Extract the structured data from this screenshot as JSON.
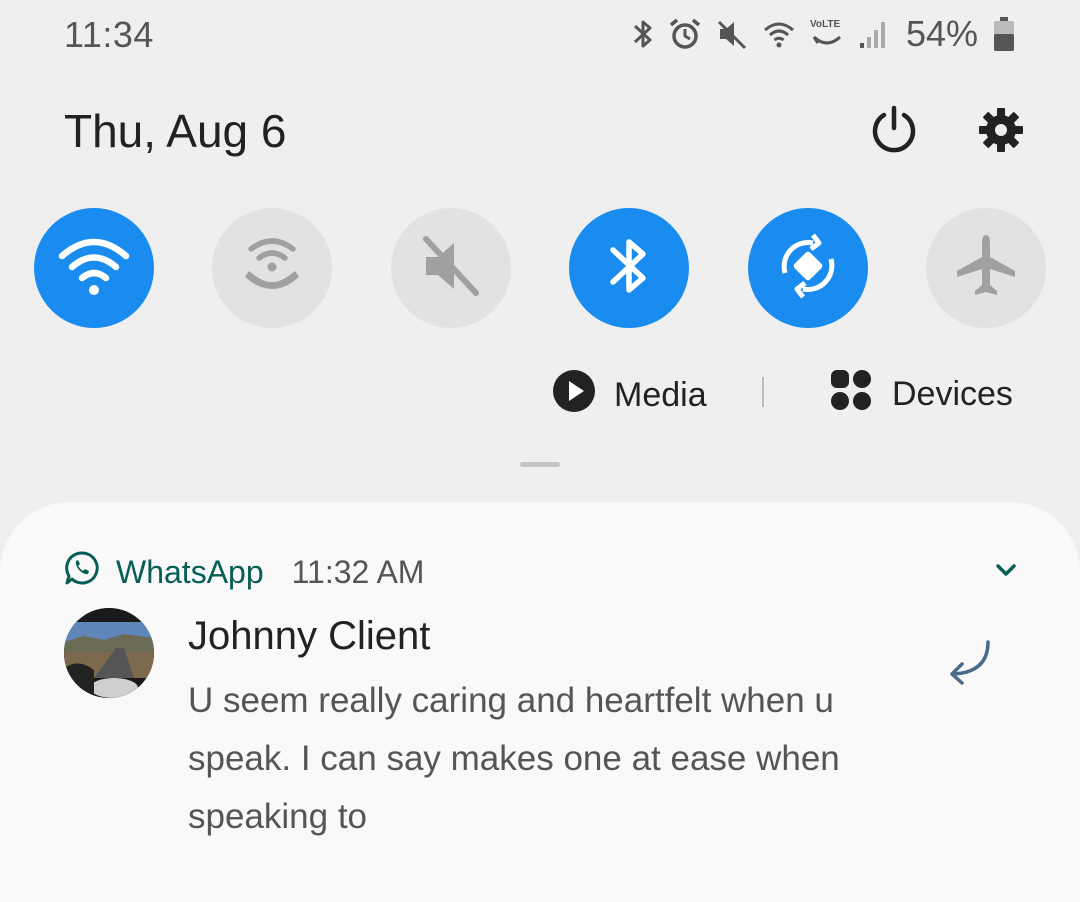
{
  "status_bar": {
    "time": "11:34",
    "battery_percent": "54%",
    "icons": [
      "bluetooth-icon",
      "alarm-icon",
      "mute-icon",
      "wifi-icon",
      "volte-icon",
      "signal-icon",
      "battery-icon"
    ],
    "volte_label": "VoLTE"
  },
  "header": {
    "date": "Thu, Aug 6",
    "buttons": [
      "power-icon",
      "settings-gear-icon"
    ]
  },
  "quick_tiles": [
    {
      "name": "wifi",
      "icon": "wifi-icon",
      "state": "on"
    },
    {
      "name": "wifi-calling",
      "icon": "wifi-calling-icon",
      "state": "off"
    },
    {
      "name": "sound",
      "icon": "mute-icon",
      "state": "off"
    },
    {
      "name": "bluetooth",
      "icon": "bluetooth-icon",
      "state": "on"
    },
    {
      "name": "auto-rotate",
      "icon": "auto-rotate-icon",
      "state": "on"
    },
    {
      "name": "airplane-mode",
      "icon": "airplane-icon",
      "state": "off"
    }
  ],
  "media_bar": {
    "media_label": "Media",
    "devices_label": "Devices"
  },
  "notification": {
    "app_name": "WhatsApp",
    "time": "11:32 AM",
    "sender": "Johnny Client",
    "message": "U seem really caring and heartfelt when u speak. I can say makes one at ease when speaking to"
  },
  "colors": {
    "background": "#efefef",
    "accent_blue": "#1a8cf0",
    "tile_off": "#e2e2e2",
    "whatsapp_green": "#075e54",
    "card_bg": "#f9f9f9"
  }
}
